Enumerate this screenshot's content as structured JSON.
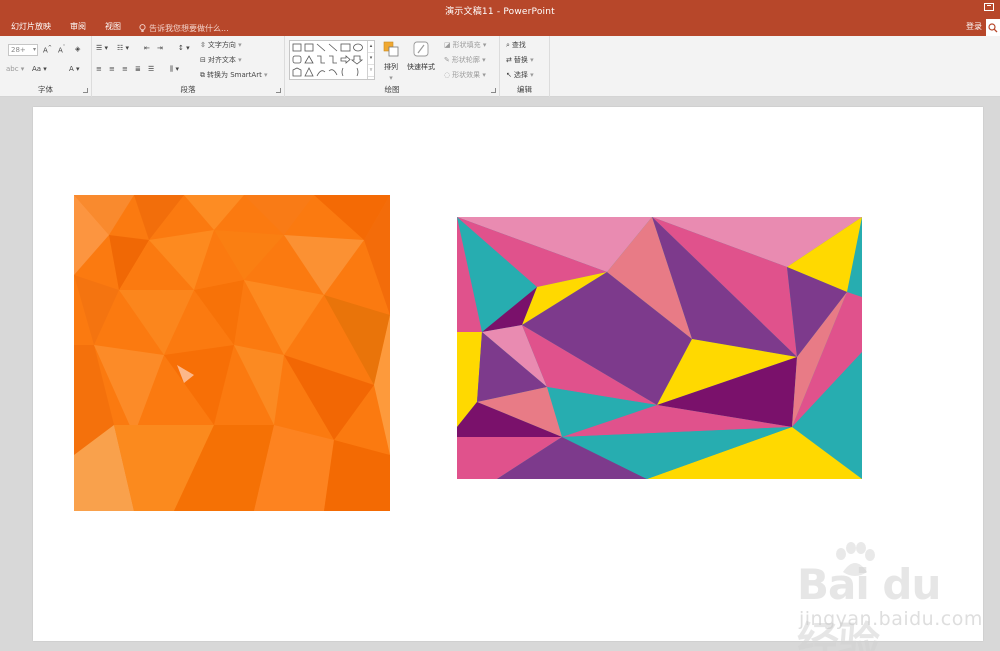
{
  "window": {
    "title": "演示文稿11 - PowerPoint",
    "login_label": "登录"
  },
  "tabs": [
    {
      "label": "幻灯片放映"
    },
    {
      "label": "审阅"
    },
    {
      "label": "视图"
    }
  ],
  "tell_me": {
    "placeholder": "告诉我您想要做什么..."
  },
  "ribbon": {
    "font": {
      "group_label": "字体",
      "size_value": "28+"
    },
    "paragraph": {
      "group_label": "段落",
      "text_direction_label": "文字方向",
      "align_text_label": "对齐文本",
      "convert_smartart_label": "转换为 SmartArt"
    },
    "drawing": {
      "group_label": "绘图",
      "arrange_label": "排列",
      "quick_styles_label": "快速样式",
      "shape_fill_label": "形状填充",
      "shape_outline_label": "形状轮廓",
      "shape_effects_label": "形状效果"
    },
    "editing": {
      "group_label": "编辑",
      "find_label": "查找",
      "replace_label": "替换",
      "select_label": "选择"
    }
  },
  "watermark": {
    "brand": "Bai du 经验",
    "url": "jingyan.baidu.com"
  },
  "colors": {
    "accent": "#b7472a",
    "orange": "#fb7a10",
    "pink": "#e0528c",
    "light_pink": "#e98bb1",
    "teal": "#27adb0",
    "yellow": "#ffd900",
    "purple": "#7d3a8c",
    "magenta": "#7a116b",
    "salmon": "#e87b86"
  }
}
